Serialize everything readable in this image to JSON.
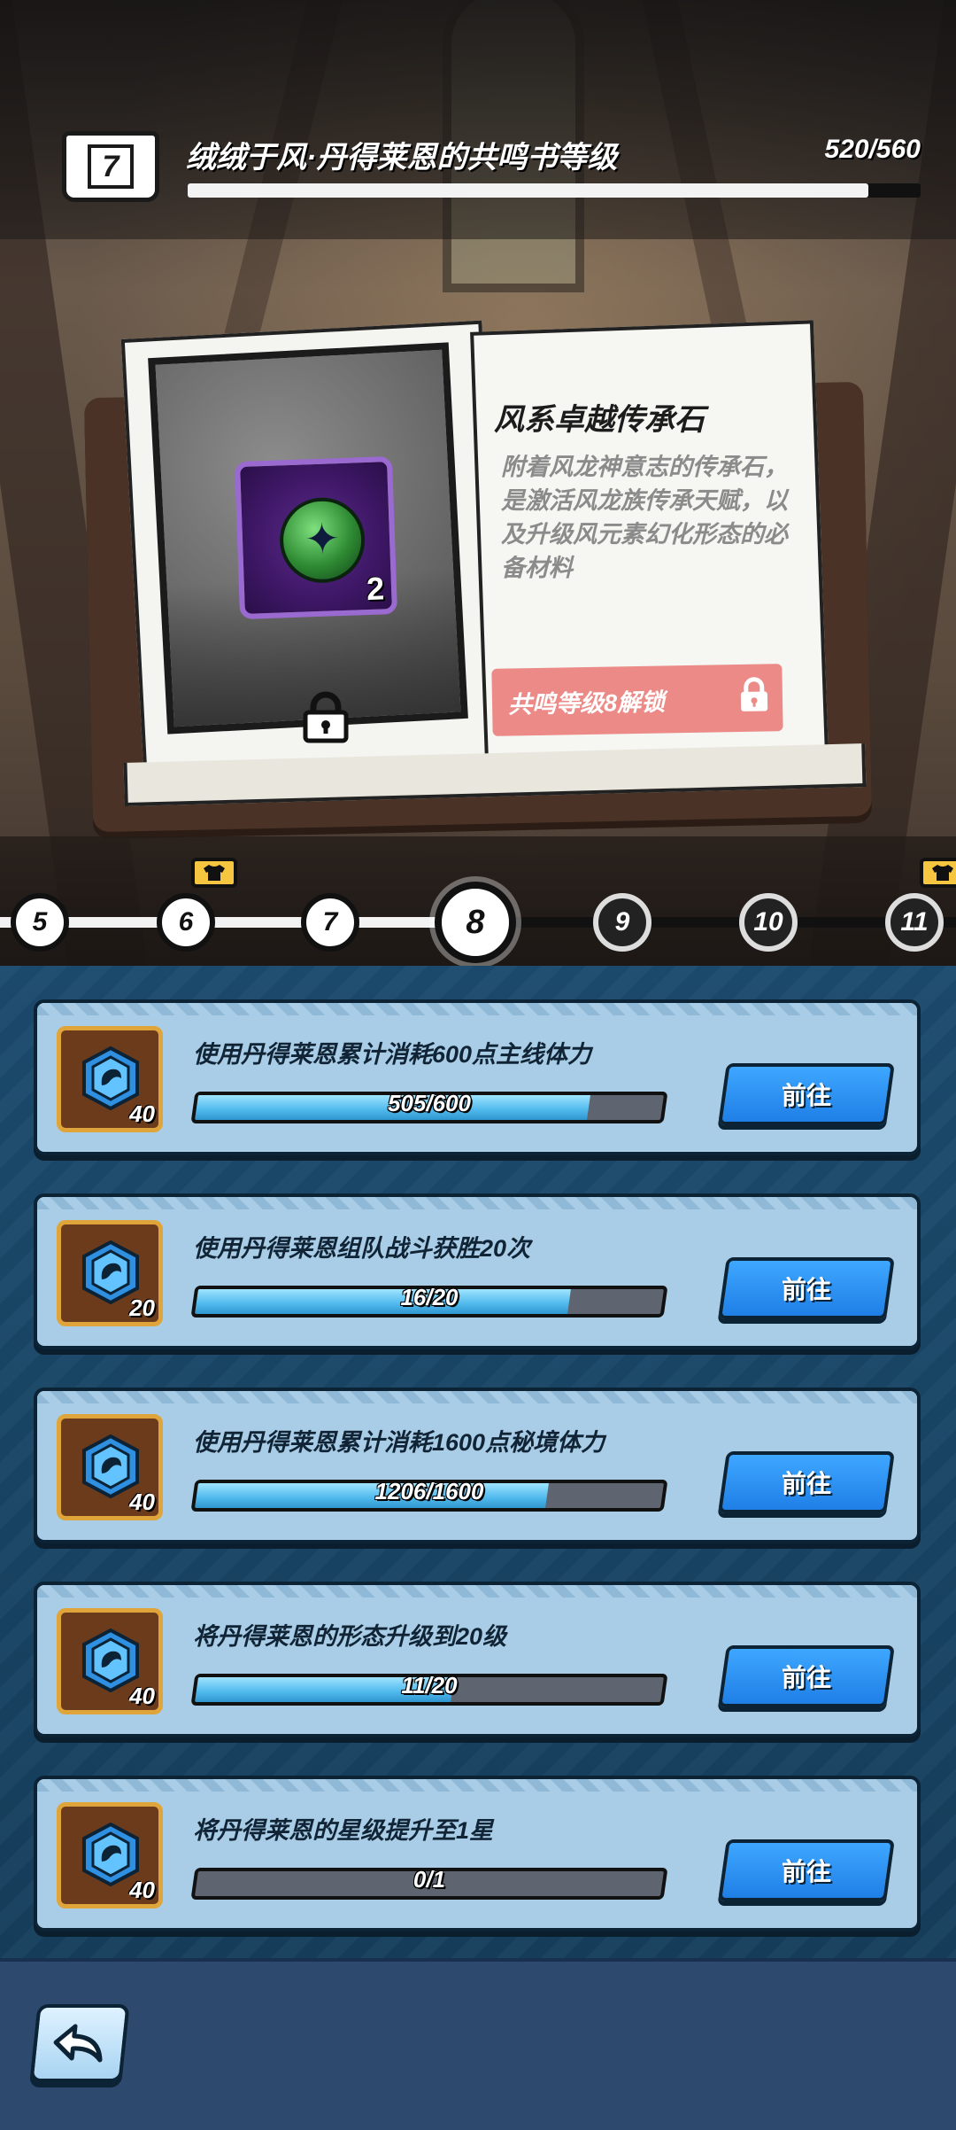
{
  "header": {
    "level": "7",
    "title": "绒绒于风·丹得莱恩的共鸣书等级",
    "progress_text": "520/560",
    "progress_current": 520,
    "progress_max": 560
  },
  "reward": {
    "item_count": "2",
    "title": "风系卓越传承石",
    "description": "附着风龙神意志的传承石，是激活风龙族传承天赋，以及升级风元素幻化形态的必备材料",
    "unlock_label": "共鸣等级8解锁"
  },
  "levels": [
    {
      "label": "5",
      "state": "done"
    },
    {
      "label": "6",
      "state": "done",
      "badge": true
    },
    {
      "label": "7",
      "state": "done"
    },
    {
      "label": "8",
      "state": "current"
    },
    {
      "label": "9",
      "state": "locked"
    },
    {
      "label": "10",
      "state": "locked"
    },
    {
      "label": "11",
      "state": "locked",
      "badge": true
    }
  ],
  "tasks": [
    {
      "description": "使用丹得莱恩累计消耗600点主线体力",
      "reward_count": "40",
      "progress_text": "505/600",
      "current": 505,
      "max": 600,
      "button_label": "前往"
    },
    {
      "description": "使用丹得莱恩组队战斗获胜20次",
      "reward_count": "20",
      "progress_text": "16/20",
      "current": 16,
      "max": 20,
      "button_label": "前往"
    },
    {
      "description": "使用丹得莱恩累计消耗1600点秘境体力",
      "reward_count": "40",
      "progress_text": "1206/1600",
      "current": 1206,
      "max": 1600,
      "button_label": "前往"
    },
    {
      "description": "将丹得莱恩的形态升级到20级",
      "reward_count": "40",
      "progress_text": "11/20",
      "current": 11,
      "max": 20,
      "button_label": "前往"
    },
    {
      "description": "将丹得莱恩的星级提升至1星",
      "reward_count": "40",
      "progress_text": "0/1",
      "current": 0,
      "max": 1,
      "button_label": "前往"
    }
  ],
  "colors": {
    "accent_blue": "#1f7fe6",
    "card_bg": "#a9cde6",
    "unlock_pink": "#eb8a86",
    "item_purple": "#3e1766"
  },
  "icons": {
    "level_book": "book-icon",
    "lock": "lock-icon",
    "back": "back-arrow-icon",
    "task_reward": "hex-crystal-icon",
    "level_badge": "shirt-icon"
  }
}
